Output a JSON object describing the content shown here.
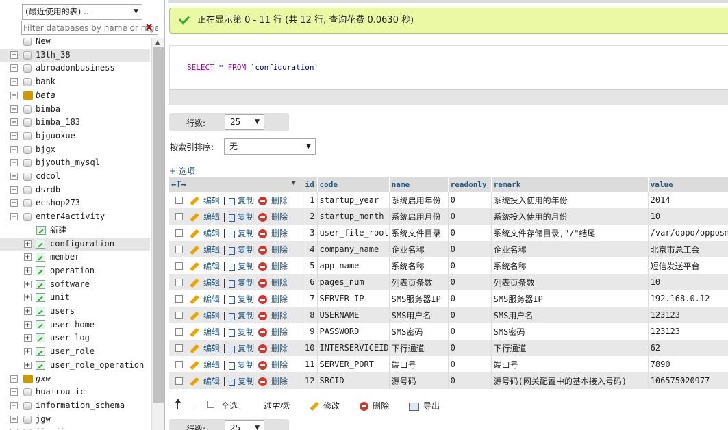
{
  "sidebar": {
    "recent_select": "(最近使用的表) ...",
    "filter_placeholder": "Filter databases by name or regex",
    "filter_clear": "X",
    "new_label": "New",
    "databases": [
      "13th_38",
      "abroadonbusiness",
      "bank",
      "beta",
      "bimba",
      "bimba_183",
      "bjguoxue",
      "bjgx",
      "bjyouth_mysql",
      "cdcol",
      "dsrdb",
      "ecshop273",
      "enter4activity"
    ],
    "open_db": {
      "new_label": "新建",
      "tables": [
        "configuration",
        "member",
        "operation",
        "software",
        "unit",
        "users",
        "user_home",
        "user_log",
        "user_role",
        "user_role_operation"
      ]
    },
    "databases_after": [
      "gxw",
      "huairou_ic",
      "information_schema",
      "jgw",
      "jingjie"
    ]
  },
  "main": {
    "success_msg": "正在显示第 0 - 11 行 (共 12 行, 查询花费 0.0630 秒)",
    "sql": {
      "select": "SELECT",
      "star": " * ",
      "from": "FROM",
      "table": " `configuration`"
    },
    "rows_label": "行数:",
    "rows_value": "25",
    "sort_label": "按索引排序:",
    "sort_value": "无",
    "options_label": "+ 选项",
    "columns": [
      "id",
      "code",
      "name",
      "readonly",
      "remark",
      "value"
    ],
    "actions": {
      "edit": "编辑",
      "copy": "复制",
      "delete": "删除"
    },
    "rows": [
      {
        "id": "1",
        "code": "startup_year",
        "name": "系统启用年份",
        "readonly": "0",
        "remark": "系统投入使用的年份",
        "value": "2014"
      },
      {
        "id": "2",
        "code": "startup_month",
        "name": "系统启用月份",
        "readonly": "0",
        "remark": "系统投入使用的月份",
        "value": "10"
      },
      {
        "id": "3",
        "code": "user_file_root",
        "name": "系统文件目录",
        "readonly": "0",
        "remark": "系统文件存储目录,\"/\"结尾",
        "value": "/var/oppo/opposm"
      },
      {
        "id": "4",
        "code": "company_name",
        "name": "企业名称",
        "readonly": "0",
        "remark": "企业名称",
        "value": "北京市总工会"
      },
      {
        "id": "5",
        "code": "app_name",
        "name": "系统名称",
        "readonly": "0",
        "remark": "系统名称",
        "value": "短信发送平台"
      },
      {
        "id": "6",
        "code": "pages_num",
        "name": "列表页条数",
        "readonly": "0",
        "remark": "列表页条数",
        "value": "10"
      },
      {
        "id": "7",
        "code": "SERVER_IP",
        "name": "SMS服务器IP",
        "readonly": "0",
        "remark": "SMS服务器IP",
        "value": "192.168.0.12"
      },
      {
        "id": "8",
        "code": "USERNAME",
        "name": "SMS用户名",
        "readonly": "0",
        "remark": "SMS用户名",
        "value": "123123"
      },
      {
        "id": "9",
        "code": "PASSWORD",
        "name": "SMS密码",
        "readonly": "0",
        "remark": "SMS密码",
        "value": "123123"
      },
      {
        "id": "10",
        "code": "INTERSERVICEID",
        "name": "下行通道",
        "readonly": "0",
        "remark": "下行通道",
        "value": "62"
      },
      {
        "id": "11",
        "code": "SERVER_PORT",
        "name": "端口号",
        "readonly": "0",
        "remark": "端口号",
        "value": "7890"
      },
      {
        "id": "12",
        "code": "SRCID",
        "name": "源号码",
        "readonly": "0",
        "remark": "源号码(网关配置中的基本接入号码)",
        "value": "106575020977"
      }
    ],
    "bottom": {
      "check_all": "全选",
      "with_selected": "选中项:",
      "modify": "修改",
      "delete": "删除",
      "export": "导出"
    }
  }
}
